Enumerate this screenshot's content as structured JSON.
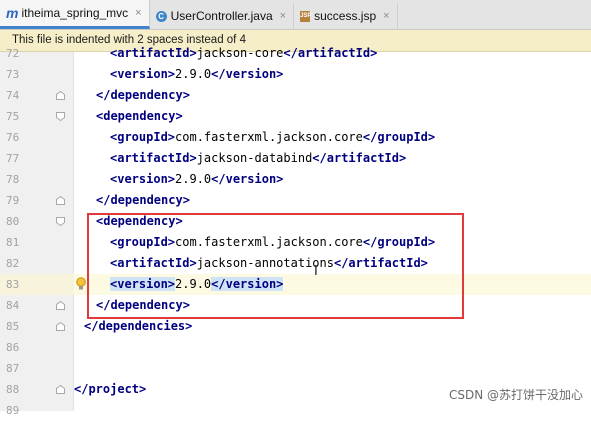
{
  "tabs": [
    {
      "label": "itheima_spring_mvc",
      "icon": "maven-m-icon",
      "active": true
    },
    {
      "label": "UserController.java",
      "icon": "java-class-icon",
      "active": false
    },
    {
      "label": "success.jsp",
      "icon": "jsp-file-icon",
      "active": false
    }
  ],
  "tab_close_glyph": "×",
  "banner": {
    "text": "This file is indented with 2 spaces instead of 4"
  },
  "editor": {
    "lines": [
      {
        "num": "72",
        "indent": 2,
        "parts": [
          {
            "t": "tag",
            "v": "<artifactId>"
          },
          {
            "t": "txt",
            "v": "jackson-core"
          },
          {
            "t": "tag",
            "v": "</artifactId>"
          }
        ]
      },
      {
        "num": "73",
        "indent": 2,
        "parts": [
          {
            "t": "tag",
            "v": "<version>"
          },
          {
            "t": "txt",
            "v": "2.9.0"
          },
          {
            "t": "tag",
            "v": "</version>"
          }
        ]
      },
      {
        "num": "74",
        "indent": 1,
        "fold": "end",
        "parts": [
          {
            "t": "tag",
            "v": "</dependency>"
          }
        ]
      },
      {
        "num": "75",
        "indent": 1,
        "fold": "start",
        "parts": [
          {
            "t": "tag",
            "v": "<dependency>"
          }
        ]
      },
      {
        "num": "76",
        "indent": 2,
        "parts": [
          {
            "t": "tag",
            "v": "<groupId>"
          },
          {
            "t": "txt",
            "v": "com.fasterxml.jackson.core"
          },
          {
            "t": "tag",
            "v": "</groupId>"
          }
        ]
      },
      {
        "num": "77",
        "indent": 2,
        "parts": [
          {
            "t": "tag",
            "v": "<artifactId>"
          },
          {
            "t": "txt",
            "v": "jackson-databind"
          },
          {
            "t": "tag",
            "v": "</artifactId>"
          }
        ]
      },
      {
        "num": "78",
        "indent": 2,
        "parts": [
          {
            "t": "tag",
            "v": "<version>"
          },
          {
            "t": "txt",
            "v": "2.9.0"
          },
          {
            "t": "tag",
            "v": "</version>"
          }
        ]
      },
      {
        "num": "79",
        "indent": 1,
        "fold": "end",
        "parts": [
          {
            "t": "tag",
            "v": "</dependency>"
          }
        ]
      },
      {
        "num": "80",
        "indent": 1,
        "fold": "start",
        "parts": [
          {
            "t": "tag",
            "v": "<dependency>"
          }
        ]
      },
      {
        "num": "81",
        "indent": 2,
        "parts": [
          {
            "t": "tag",
            "v": "<groupId>"
          },
          {
            "t": "txt",
            "v": "com.fasterxml.jackson.core"
          },
          {
            "t": "tag",
            "v": "</groupId>"
          }
        ]
      },
      {
        "num": "82",
        "indent": 2,
        "parts": [
          {
            "t": "tag",
            "v": "<artifactId>"
          },
          {
            "t": "txt",
            "v": "jackson-annotations"
          },
          {
            "t": "tag",
            "v": "</artifactId>"
          }
        ]
      },
      {
        "num": "83",
        "indent": 2,
        "current": true,
        "bulb": true,
        "parts": [
          {
            "t": "tag",
            "v": "<version>",
            "hl": true
          },
          {
            "t": "txt",
            "v": "2.9.0"
          },
          {
            "t": "tag",
            "v": "</version>",
            "hl": true
          }
        ]
      },
      {
        "num": "84",
        "indent": 1,
        "fold": "end",
        "parts": [
          {
            "t": "tag",
            "v": "</dependency>"
          }
        ]
      },
      {
        "num": "85",
        "indent": 0,
        "fold": "end",
        "parts": [
          {
            "t": "tag",
            "v": "</dependencies>"
          }
        ]
      },
      {
        "num": "86",
        "indent": 0,
        "parts": []
      },
      {
        "num": "87",
        "indent": 0,
        "parts": []
      },
      {
        "num": "88",
        "indent": -1,
        "fold": "end",
        "parts": [
          {
            "t": "tag",
            "v": "</project>"
          }
        ]
      },
      {
        "num": "89",
        "indent": 0,
        "parts": []
      }
    ]
  },
  "watermark": {
    "text": "CSDN @苏打饼干没加心"
  },
  "colors": {
    "tag": "#000080",
    "highlight": "#cfe3f6",
    "selection_box": "#e23a3a",
    "banner_bg": "#f5eec8"
  }
}
